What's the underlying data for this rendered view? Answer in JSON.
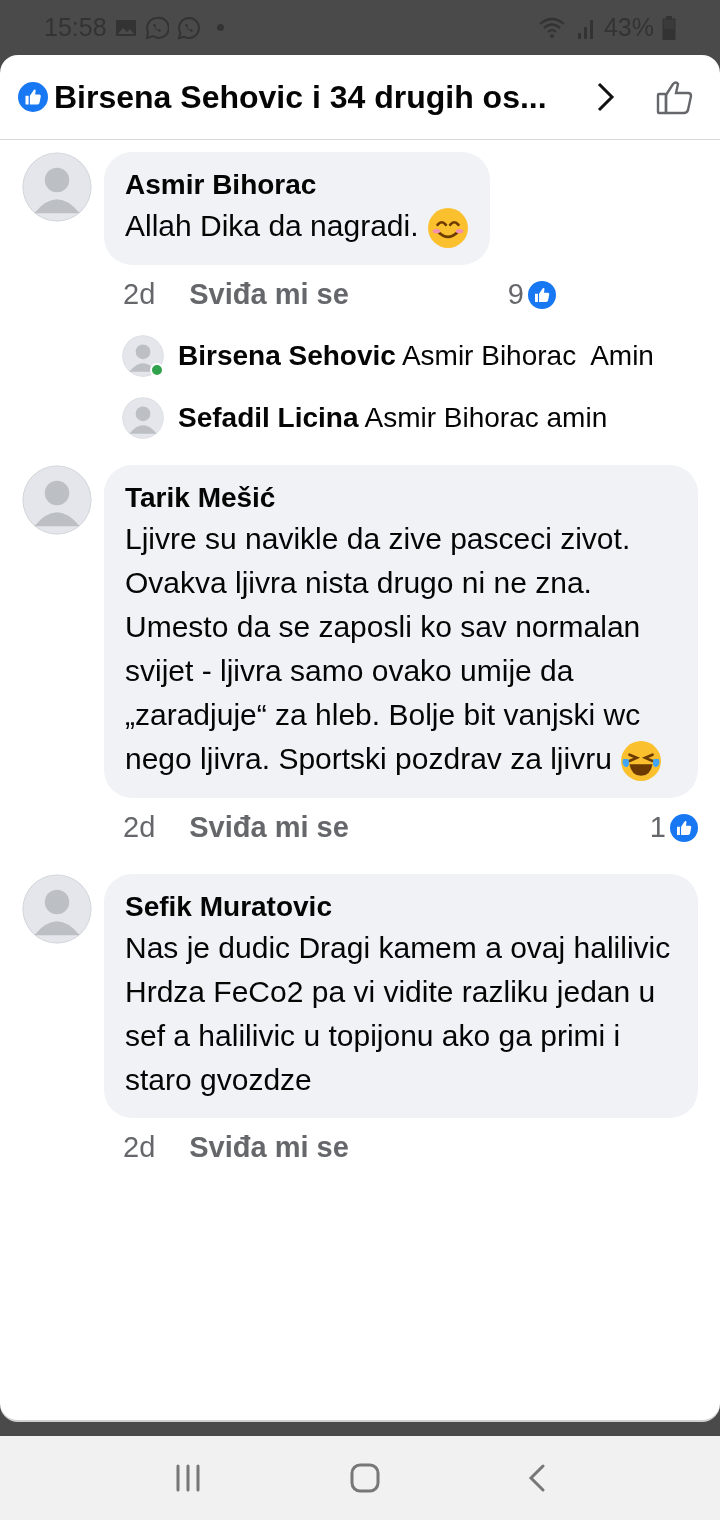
{
  "status_bar": {
    "time": "15:58",
    "battery": "43%"
  },
  "header": {
    "title": "Birsena Sehovic i 34 drugih os..."
  },
  "comments": [
    {
      "kind": "smile",
      "author": "Asmir Bihorac",
      "text": "Allah Dika da nagradi.",
      "age": "2d",
      "like_label": "Sviđa mi se",
      "reactions": "9",
      "replies": [
        {
          "author": "Birsena Sehovic",
          "text": "Asmir Bihorac  Amin",
          "online": true
        },
        {
          "author": "Sefadil Licina",
          "text": "Asmir Bihorac amin",
          "online": false
        }
      ]
    },
    {
      "kind": "laugh",
      "author": "Tarik Mešić",
      "text": "Ljivre su navikle da zive pasceci zivot. Ovakva ljivra nista drugo ni ne zna. Umesto da se zaposli ko sav normalan svijet - ljivra samo ovako umije da „zaradjuje“ za hleb. Bolje bit vanjski wc nego ljivra. Sportski pozdrav za ljivru",
      "age": "2d",
      "like_label": "Sviđa mi se",
      "reactions": "1"
    },
    {
      "kind": "plain",
      "author": "Sefik Muratovic",
      "text": "Nas je dudic Dragi kamem a ovaj halilivic Hrdza FeCo2 pa vi vidite razliku jedan u sef a halilivic u topijonu ako ga primi i staro gvozdze",
      "age": "2d",
      "like_label": "Sviđa mi se"
    }
  ]
}
